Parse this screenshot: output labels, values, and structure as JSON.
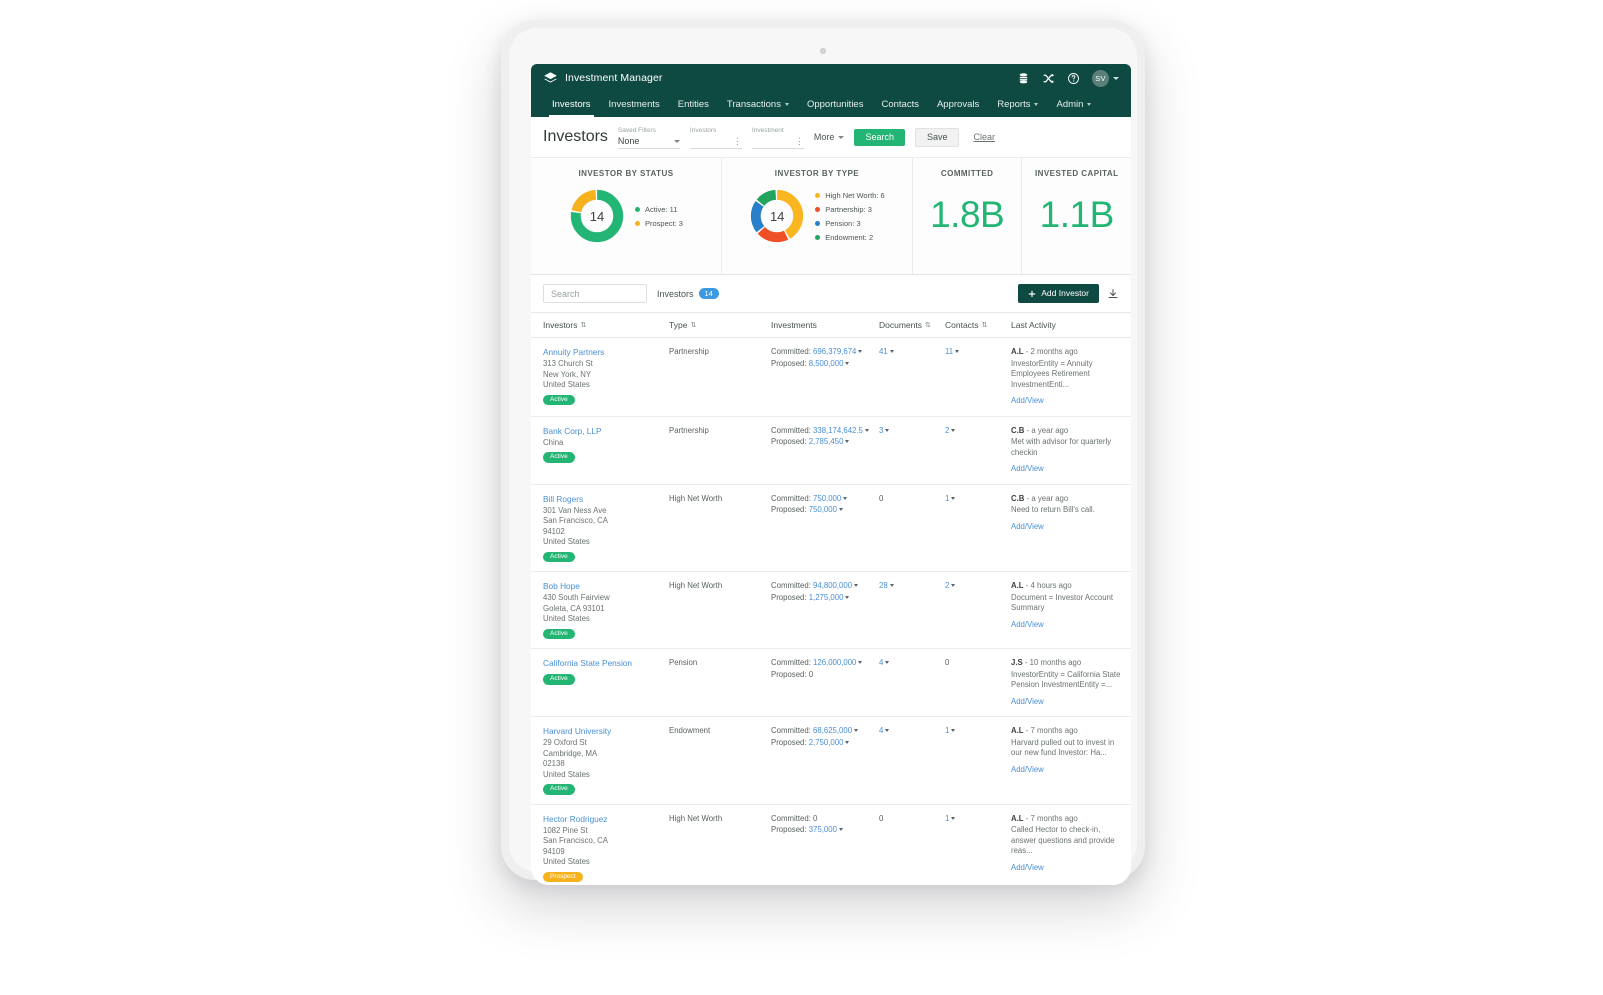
{
  "app": {
    "brand": "Investment Manager",
    "logo_icon": "layers-icon",
    "header_icons": [
      {
        "name": "database-icon",
        "label": "Database"
      },
      {
        "name": "shuffle-icon",
        "label": "Shuffle"
      },
      {
        "name": "help-circle-icon",
        "label": "Help"
      }
    ],
    "avatar_initials": "SV"
  },
  "nav": {
    "items": [
      {
        "label": "Investors",
        "active": true,
        "caret": false
      },
      {
        "label": "Investments",
        "active": false,
        "caret": false
      },
      {
        "label": "Entities",
        "active": false,
        "caret": false
      },
      {
        "label": "Transactions",
        "active": false,
        "caret": true
      },
      {
        "label": "Opportunities",
        "active": false,
        "caret": false
      },
      {
        "label": "Contacts",
        "active": false,
        "caret": false
      },
      {
        "label": "Approvals",
        "active": false,
        "caret": false
      },
      {
        "label": "Reports",
        "active": false,
        "caret": true
      },
      {
        "label": "Admin",
        "active": false,
        "caret": true
      }
    ]
  },
  "page": {
    "title": "Investors",
    "filters": {
      "saved_filters_label": "Saved Filters",
      "saved_filters_value": "None",
      "investors_label": "Investors",
      "investors_value": "",
      "investment_label": "Investment",
      "investment_value": "",
      "more_label": "More",
      "search_button": "Search",
      "save_button": "Save",
      "clear_button": "Clear"
    }
  },
  "kpis": {
    "status_card_title": "INVESTOR BY STATUS",
    "type_card_title": "INVESTOR BY TYPE",
    "committed_title": "COMMITTED",
    "committed_value": "1.8B",
    "invested_title": "INVESTED CAPITAL",
    "invested_value": "1.1B",
    "accent_green": "#22b573"
  },
  "chart_data": [
    {
      "type": "pie",
      "title": "INVESTOR BY STATUS",
      "center_label": "14",
      "total": 14,
      "labels": [
        "Active",
        "Prospect"
      ],
      "values": [
        11,
        3
      ],
      "colors": [
        "#22b573",
        "#f5b21c"
      ],
      "legend_entries": [
        "Active: 11",
        "Prospect: 3"
      ],
      "legend_position": "right"
    },
    {
      "type": "pie",
      "title": "INVESTOR BY TYPE",
      "center_label": "14",
      "total": 14,
      "labels": [
        "High Net Worth",
        "Partnership",
        "Pension",
        "Endowment"
      ],
      "values": [
        6,
        3,
        3,
        2
      ],
      "colors": [
        "#f9b621",
        "#ef4f25",
        "#2a7fc9",
        "#22a35e"
      ],
      "legend_entries": [
        "High Net Worth: 6",
        "Partnership: 3",
        "Pension: 3",
        "Endowment: 2"
      ],
      "legend_position": "right"
    }
  ],
  "toolbar": {
    "search_placeholder": "Search",
    "search_value": "",
    "count_label": "Investors",
    "count_value": "14",
    "add_label": "Add Investor",
    "download_icon": "download-icon"
  },
  "table": {
    "columns": [
      {
        "label": "Investors",
        "sortable": true
      },
      {
        "label": "Type",
        "sortable": true
      },
      {
        "label": "Investments",
        "sortable": false
      },
      {
        "label": "Documents",
        "sortable": true
      },
      {
        "label": "Contacts",
        "sortable": true
      },
      {
        "label": "Last Activity",
        "sortable": false
      }
    ],
    "rows": [
      {
        "name": "Annuity Partners",
        "address": [
          "313 Church St",
          "New York, NY",
          "United States"
        ],
        "status": "Active",
        "status_kind": "active",
        "type": "Partnership",
        "committed_label": "Committed:",
        "committed_value": "696,379,674",
        "committed_inline": false,
        "proposed_label": "Proposed:",
        "proposed_value": "8,500,000",
        "proposed_inline": true,
        "documents": "41",
        "documents_link": true,
        "contacts": "11",
        "contacts_link": true,
        "activity_user": "A.L",
        "activity_time": "2 months ago",
        "activity_text": "InvestorEntity = Annuity Employees Retirement InvestmentEnti...",
        "addview": "Add/View"
      },
      {
        "name": "Bank Corp, LLP",
        "address": [
          "China"
        ],
        "status": "Active",
        "status_kind": "active",
        "type": "Partnership",
        "committed_label": "Committed:",
        "committed_value": "338,174,642.5",
        "committed_inline": false,
        "proposed_label": "Proposed:",
        "proposed_value": "2,785,450",
        "proposed_inline": true,
        "documents": "3",
        "documents_link": true,
        "contacts": "2",
        "contacts_link": true,
        "activity_user": "C.B",
        "activity_time": "a year ago",
        "activity_text": "Met with advisor for quarterly checkin",
        "addview": "Add/View"
      },
      {
        "name": "Bill Rogers",
        "address": [
          "301 Van Ness Ave",
          "San Francisco, CA",
          "94102",
          "United States"
        ],
        "status": "Active",
        "status_kind": "active",
        "type": "High Net Worth",
        "committed_label": "Committed:",
        "committed_value": "750,000",
        "committed_inline": true,
        "proposed_label": "Proposed:",
        "proposed_value": "750,000",
        "proposed_inline": true,
        "documents": "0",
        "documents_link": false,
        "contacts": "1",
        "contacts_link": true,
        "activity_user": "C.B",
        "activity_time": "a year ago",
        "activity_text": "Need to return Bill's call.",
        "addview": "Add/View"
      },
      {
        "name": "Bob Hope",
        "address": [
          "430 South Fairview",
          "Goleta, CA 93101",
          "United States"
        ],
        "status": "Active",
        "status_kind": "active",
        "type": "High Net Worth",
        "committed_label": "Committed:",
        "committed_value": "94,800,000",
        "committed_inline": false,
        "proposed_label": "Proposed:",
        "proposed_value": "1,275,000",
        "proposed_inline": true,
        "documents": "28",
        "documents_link": true,
        "contacts": "2",
        "contacts_link": true,
        "activity_user": "A.L",
        "activity_time": "4 hours ago",
        "activity_text": "Document = Investor Account Summary",
        "addview": "Add/View"
      },
      {
        "name": "California State Pension",
        "address": [],
        "status": "Active",
        "status_kind": "active",
        "type": "Pension",
        "committed_label": "Committed:",
        "committed_value": "126,000,000",
        "committed_inline": false,
        "proposed_label": "Proposed:",
        "proposed_value": "0",
        "proposed_inline": true,
        "proposed_plain": true,
        "documents": "4",
        "documents_link": true,
        "contacts": "0",
        "contacts_link": false,
        "activity_user": "J.S",
        "activity_time": "10 months ago",
        "activity_text": "InvestorEntity = California State Pension InvestmentEntity =...",
        "addview": "Add/View"
      },
      {
        "name": "Harvard University",
        "address": [
          "29 Oxford St",
          "Cambridge, MA",
          "02138",
          "United States"
        ],
        "status": "Active",
        "status_kind": "active",
        "type": "Endowment",
        "committed_label": "Committed:",
        "committed_value": "68,625,000",
        "committed_inline": false,
        "proposed_label": "Proposed:",
        "proposed_value": "2,750,000",
        "proposed_inline": true,
        "documents": "4",
        "documents_link": true,
        "contacts": "1",
        "contacts_link": true,
        "activity_user": "A.L",
        "activity_time": "7 months ago",
        "activity_text": "Harvard pulled out to invest in our new fund Investor: Ha...",
        "addview": "Add/View"
      },
      {
        "name": "Hector Rodriguez",
        "address": [
          "1082 Pine St",
          "San Francisco, CA",
          "94109",
          "United States"
        ],
        "status": "Prospect",
        "status_kind": "prospect",
        "type": "High Net Worth",
        "committed_label": "Committed:",
        "committed_value": "0",
        "committed_inline": true,
        "committed_plain": true,
        "proposed_label": "Proposed:",
        "proposed_value": "375,000",
        "proposed_inline": true,
        "documents": "0",
        "documents_link": false,
        "contacts": "1",
        "contacts_link": true,
        "activity_user": "A.L",
        "activity_time": "7 months ago",
        "activity_text": "Called Hector to check-in, answer questions and provide reas...",
        "addview": "Add/View"
      }
    ]
  }
}
